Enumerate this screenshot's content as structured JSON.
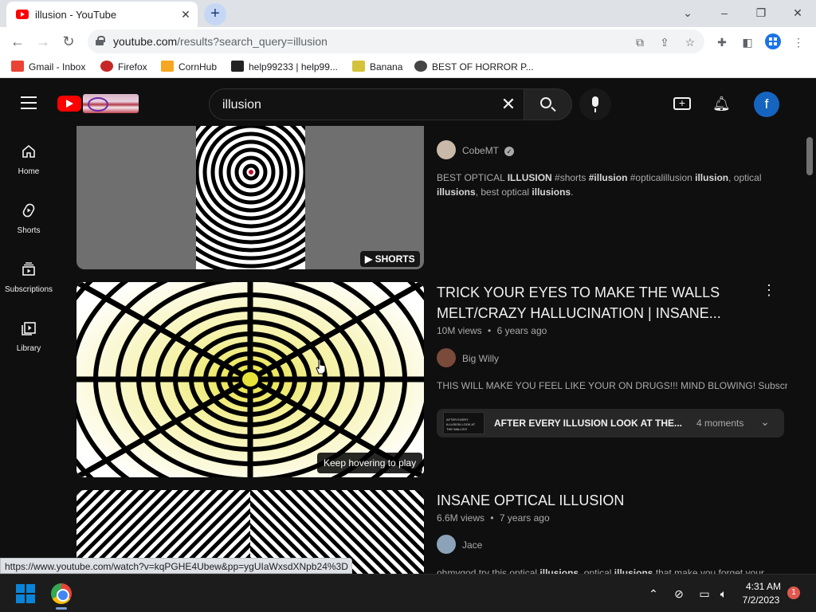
{
  "browser": {
    "tab_title": "illusion - YouTube",
    "tab_close": "✕",
    "new_tab": "+",
    "window_controls": {
      "dropdown": "⌄",
      "minimize": "–",
      "restore": "❐",
      "close": "✕"
    },
    "nav": {
      "back": "←",
      "forward": "→",
      "reload": "↻"
    },
    "url_host": "youtube.com",
    "url_path": "/results?search_query=illusion",
    "omnibox_icons": [
      "open-in-app-icon",
      "share-icon",
      "bookmark-star-icon"
    ],
    "toolbar_icons": [
      "extensions-icon",
      "side-panel-icon",
      "profile-icon",
      "more-icon"
    ],
    "bookmarks": [
      {
        "label": "Gmail - Inbox",
        "icon": "gmail-icon",
        "color": "#ea4335"
      },
      {
        "label": "Firefox",
        "icon": "firefox-icon",
        "color": "#c62828"
      },
      {
        "label": "CornHub",
        "icon": "cornhub-icon",
        "color": "#f5a623"
      },
      {
        "label": "help99233 | help99...",
        "icon": "wix-icon",
        "color": "#222222"
      },
      {
        "label": "Banana",
        "icon": "banana-icon",
        "color": "#d4c23a"
      },
      {
        "label": "BEST OF HORROR P...",
        "icon": "globe-icon",
        "color": "#444444"
      }
    ]
  },
  "youtube": {
    "search": {
      "query": "illusion"
    },
    "avatar_letter": "f",
    "guide": [
      {
        "label": "Home",
        "icon": "home-icon"
      },
      {
        "label": "Shorts",
        "icon": "shorts-icon"
      },
      {
        "label": "Subscriptions",
        "icon": "subscriptions-icon"
      },
      {
        "label": "Library",
        "icon": "library-icon"
      }
    ],
    "results": [
      {
        "channel": "CobeMT",
        "verified": "✓",
        "badge": "SHORTS",
        "description_html": "BEST OPTICAL <b>ILLUSION</b> #shorts <b>#illusion</b> #opticalillusion <b>illusion</b>, optical <b>illusions</b>, best optical <b>illusions</b>."
      },
      {
        "title_line1": "TRICK YOUR EYES TO MAKE THE WALLS",
        "title_line2": "MELT/CRAZY HALLUCINATION | INSANE...",
        "views": "10M views",
        "age": "6 years ago",
        "channel": "Big Willy",
        "description": "THIS WILL MAKE YOU FEEL LIKE YOUR ON DRUGS!!! MIND BLOWING! Subscribe...",
        "hover_tooltip": "Keep hovering to play",
        "moments_title": "AFTER EVERY ILLUSION LOOK AT THE...",
        "moments_thumb_text": "AFTER EVERY ILLUSION LOOK AT THE WALLS!!!",
        "moments_count": "4 moments"
      },
      {
        "title": "INSANE OPTICAL ILLUSION",
        "views": "6.6M views",
        "age": "7 years ago",
        "channel": "Jace",
        "description_html": "ohmygod try this optical <b>illusions</b>, optical <b>illusions</b> that make you forget your"
      }
    ],
    "dot_separator": "•"
  },
  "status_url": "https://www.youtube.com/watch?v=kqPGHE4Ubew&pp=ygUIaWxsdXNpb24%3D",
  "taskbar": {
    "time": "4:31 AM",
    "date": "7/2/2023",
    "notification_count": "1",
    "tray_icons": [
      "chevron-up-icon",
      "network-off-icon",
      "display-icon",
      "volume-icon"
    ]
  }
}
